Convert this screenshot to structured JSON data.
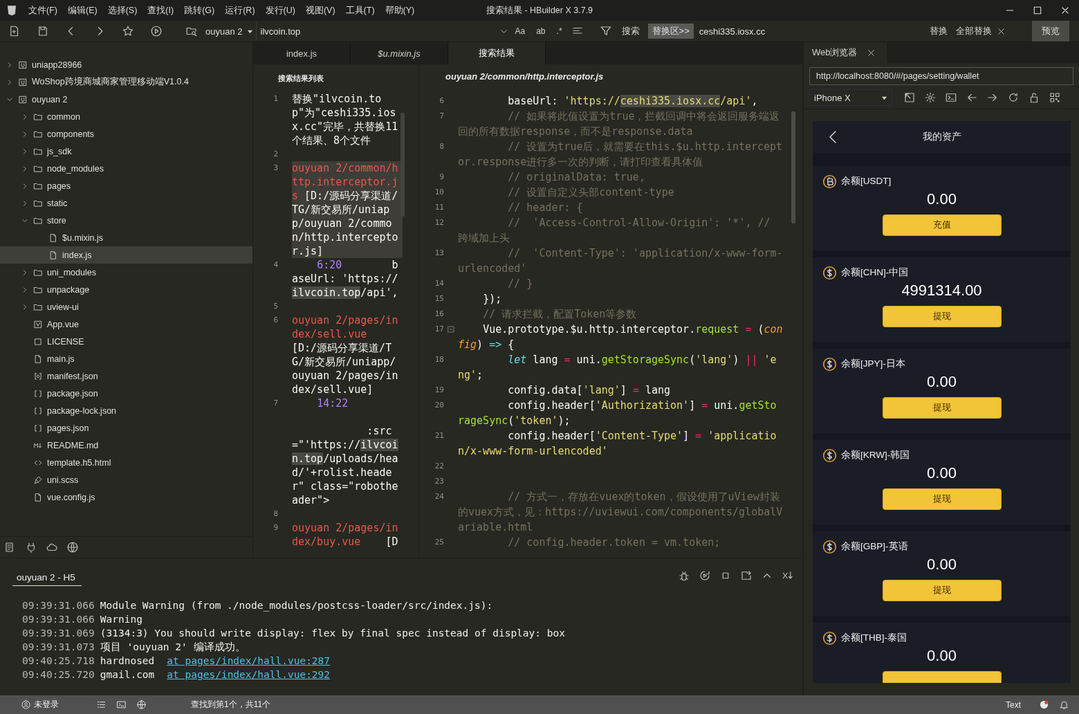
{
  "window": {
    "title": "搜索结果 - HBuilder X 3.7.9",
    "menu": [
      "文件(F)",
      "编辑(E)",
      "选择(S)",
      "查找(I)",
      "跳转(G)",
      "运行(R)",
      "发行(U)",
      "视图(V)",
      "工具(T)",
      "帮助(Y)"
    ]
  },
  "toolbar": {
    "project": "ouyuan 2",
    "search": {
      "value": "ilvcoin.top"
    },
    "search_options": [
      {
        "label": "Aa",
        "on": false
      },
      {
        "label": "ab",
        "on": false
      },
      {
        "label": ".*",
        "on": false
      }
    ],
    "search_button": "搜索",
    "replace_toggle": "替换区>>",
    "replace": {
      "value": "ceshi335.iosx.cc"
    },
    "replace_button": "替换",
    "replace_all_button": "全部替换",
    "preview_button": "预览"
  },
  "sidebar": {
    "tree": [
      {
        "label": "uniapp28966",
        "kind": "project",
        "expanded": false,
        "selected": false
      },
      {
        "label": "WoShop跨境商城商家管理移动端V1.0.4",
        "kind": "project",
        "expanded": false,
        "selected": false
      },
      {
        "label": "ouyuan 2",
        "kind": "project",
        "expanded": true,
        "selected": false,
        "children": [
          {
            "label": "common",
            "kind": "folder",
            "expanded": false,
            "selected": false
          },
          {
            "label": "components",
            "kind": "folder",
            "expanded": false,
            "selected": false
          },
          {
            "label": "js_sdk",
            "kind": "folder",
            "expanded": false,
            "selected": false
          },
          {
            "label": "node_modules",
            "kind": "folder",
            "expanded": false,
            "selected": false
          },
          {
            "label": "pages",
            "kind": "folder",
            "expanded": false,
            "selected": false
          },
          {
            "label": "static",
            "kind": "folder",
            "expanded": false,
            "selected": false
          },
          {
            "label": "store",
            "kind": "folder",
            "expanded": true,
            "selected": false,
            "children": [
              {
                "label": "$u.mixin.js",
                "kind": "js",
                "selected": false
              },
              {
                "label": "index.js",
                "kind": "js",
                "selected": true
              }
            ]
          },
          {
            "label": "uni_modules",
            "kind": "folder",
            "expanded": false,
            "selected": false
          },
          {
            "label": "unpackage",
            "kind": "folder",
            "expanded": false,
            "selected": false
          },
          {
            "label": "uview-ui",
            "kind": "folder",
            "expanded": false,
            "selected": false
          },
          {
            "label": "App.vue",
            "kind": "vue",
            "selected": false
          },
          {
            "label": "LICENSE",
            "kind": "text",
            "selected": false
          },
          {
            "label": "main.js",
            "kind": "js",
            "selected": false
          },
          {
            "label": "manifest.json",
            "kind": "manifest",
            "selected": false
          },
          {
            "label": "package.json",
            "kind": "json",
            "selected": false
          },
          {
            "label": "package-lock.json",
            "kind": "json",
            "selected": false
          },
          {
            "label": "pages.json",
            "kind": "json",
            "selected": false
          },
          {
            "label": "README.md",
            "kind": "markdown",
            "selected": false
          },
          {
            "label": "template.h5.html",
            "kind": "html",
            "selected": false
          },
          {
            "label": "uni.scss",
            "kind": "style",
            "selected": false
          },
          {
            "label": "vue.config.js",
            "kind": "js",
            "selected": false
          }
        ]
      }
    ]
  },
  "editor": {
    "tabs": [
      {
        "label": "index.js",
        "selected": false,
        "preview": false
      },
      {
        "label": "$u.mixin.js",
        "selected": false,
        "preview": true
      },
      {
        "label": "搜索结果",
        "selected": true,
        "preview": false
      }
    ],
    "results": {
      "title": "搜索结果列表",
      "lines": [
        {
          "number": "1",
          "selected": false,
          "tokens": [
            {
              "kind": "p",
              "text": "替换\"ilvcoin.top\"为\"ceshi335.iosx.cc\"完毕，共替换11个结果、8个文件"
            }
          ]
        },
        {
          "number": "2",
          "selected": false
        },
        {
          "number": "3",
          "selected": true,
          "tokens": [
            {
              "kind": "path",
              "text": "ouyuan 2/common/http.interceptor.js"
            },
            {
              "kind": "p",
              "text": " [D:/源码分享渠道/TG/新交易所/uniapp/ouyuan 2/common/http.interceptor.js]"
            }
          ]
        },
        {
          "number": "4",
          "selected": false,
          "tokens": [
            {
              "kind": "pos",
              "text": "    6:20"
            },
            {
              "kind": "p",
              "text": "        baseUrl: 'https://"
            },
            {
              "kind": "m",
              "text": "ilvcoin.top"
            },
            {
              "kind": "p",
              "text": "/api',"
            }
          ]
        },
        {
          "number": "5",
          "selected": false
        },
        {
          "number": "6",
          "selected": false,
          "tokens": [
            {
              "kind": "path",
              "text": "ouyuan 2/pages/index/sell.vue"
            },
            {
              "kind": "p",
              "text": "   [D:/源码分享渠道/TG/新交易所/uniapp/ouyuan 2/pages/index/sell.vue]"
            }
          ]
        },
        {
          "number": "7",
          "selected": false,
          "tokens": [
            {
              "kind": "pos",
              "text": "    14:22"
            },
            {
              "kind": "p",
              "text": "                                     :src=\"'https://"
            },
            {
              "kind": "m",
              "text": "ilvcoin.top"
            },
            {
              "kind": "p",
              "text": "/uploads/head/'+rolist.header\" class=\"robotheader\">"
            }
          ]
        },
        {
          "number": "8",
          "selected": false
        },
        {
          "number": "9",
          "selected": false,
          "tokens": [
            {
              "kind": "path",
              "text": "ouyuan 2/pages/index/buy.vue"
            },
            {
              "kind": "p",
              "text": "    [D"
            }
          ]
        }
      ]
    },
    "code": {
      "file": "ouyuan 2/common/http.interceptor.js",
      "lines": [
        {
          "number": "6",
          "tokens": [
            {
              "kind": "p",
              "text": "        baseUrl: "
            },
            {
              "kind": "s",
              "text": "'https://"
            },
            {
              "kind": "m",
              "text": "ceshi335.iosx.cc"
            },
            {
              "kind": "s",
              "text": "/api'"
            },
            {
              "kind": "p",
              "text": ","
            }
          ]
        },
        {
          "number": "7",
          "tokens": [
            {
              "kind": "c",
              "text": "        // 如果将此值设置为true，拦截回调中将会返回服务端返回的所有数据response，而不是response.data"
            }
          ]
        },
        {
          "number": "8",
          "tokens": [
            {
              "kind": "c",
              "text": "        // 设置为true后，就需要在this.$u.http.interceptor.response进行多一次的判断，请打印查看具体值"
            }
          ]
        },
        {
          "number": "9",
          "tokens": [
            {
              "kind": "c",
              "text": "        // originalData: true,"
            }
          ]
        },
        {
          "number": "10",
          "tokens": [
            {
              "kind": "c",
              "text": "        // 设置自定义头部content-type"
            }
          ]
        },
        {
          "number": "11",
          "tokens": [
            {
              "kind": "c",
              "text": "        // header: {"
            }
          ]
        },
        {
          "number": "12",
          "tokens": [
            {
              "kind": "c",
              "text": "        //  'Access-Control-Allow-Origin': '*', // 跨域加上头"
            }
          ]
        },
        {
          "number": "13",
          "tokens": [
            {
              "kind": "c",
              "text": "        //  'Content-Type': 'application/x-www-form-urlencoded'"
            }
          ]
        },
        {
          "number": "14",
          "tokens": [
            {
              "kind": "c",
              "text": "        // }"
            }
          ]
        },
        {
          "number": "15",
          "tokens": [
            {
              "kind": "p",
              "text": "    });"
            }
          ]
        },
        {
          "number": "16",
          "tokens": [
            {
              "kind": "c",
              "text": "    // 请求拦截，配置Token等参数"
            }
          ]
        },
        {
          "number": "17",
          "fold": true,
          "tokens": [
            {
              "kind": "p",
              "text": "    Vue.prototype.$u.http.interceptor."
            },
            {
              "kind": "f",
              "text": "request"
            },
            {
              "kind": "o",
              "text": " ="
            },
            {
              "kind": "p",
              "text": " ("
            },
            {
              "kind": "v",
              "text": "config"
            },
            {
              "kind": "p",
              "text": ") "
            },
            {
              "kind": "k",
              "text": "=>"
            },
            {
              "kind": "p",
              "text": " {"
            }
          ]
        },
        {
          "number": "18",
          "tokens": [
            {
              "kind": "k",
              "text": "        let"
            },
            {
              "kind": "p",
              "text": " lang "
            },
            {
              "kind": "o",
              "text": "="
            },
            {
              "kind": "p",
              "text": " uni."
            },
            {
              "kind": "f",
              "text": "getStorageSync"
            },
            {
              "kind": "p",
              "text": "("
            },
            {
              "kind": "s",
              "text": "'lang'"
            },
            {
              "kind": "p",
              "text": ") "
            },
            {
              "kind": "o",
              "text": "|| "
            },
            {
              "kind": "s",
              "text": "'eng'"
            },
            {
              "kind": "p",
              "text": ";"
            }
          ]
        },
        {
          "number": "19",
          "tokens": [
            {
              "kind": "p",
              "text": "        config.data["
            },
            {
              "kind": "s",
              "text": "'lang'"
            },
            {
              "kind": "p",
              "text": "] "
            },
            {
              "kind": "o",
              "text": "="
            },
            {
              "kind": "p",
              "text": " lang"
            }
          ]
        },
        {
          "number": "20",
          "tokens": [
            {
              "kind": "p",
              "text": "        config.header["
            },
            {
              "kind": "s",
              "text": "'Authorization'"
            },
            {
              "kind": "p",
              "text": "] "
            },
            {
              "kind": "o",
              "text": "="
            },
            {
              "kind": "p",
              "text": " uni."
            },
            {
              "kind": "f",
              "text": "getStorageSync"
            },
            {
              "kind": "p",
              "text": "("
            },
            {
              "kind": "s",
              "text": "'token'"
            },
            {
              "kind": "p",
              "text": ");"
            }
          ]
        },
        {
          "number": "21",
          "tokens": [
            {
              "kind": "p",
              "text": "        config.header["
            },
            {
              "kind": "s",
              "text": "'Content-Type'"
            },
            {
              "kind": "p",
              "text": "] "
            },
            {
              "kind": "o",
              "text": "= "
            },
            {
              "kind": "s",
              "text": "'application/x-www-form-urlencoded'"
            }
          ]
        },
        {
          "number": "22"
        },
        {
          "number": "23"
        },
        {
          "number": "24",
          "tokens": [
            {
              "kind": "c",
              "text": "        // 方式一，存放在vuex的token，假设使用了uView封装的vuex方式，见：https://uviewui.com/components/globalVariable.html"
            }
          ]
        },
        {
          "number": "25",
          "tokens": [
            {
              "kind": "c",
              "text": "        // config.header.token = vm.token;"
            }
          ]
        }
      ]
    }
  },
  "console": {
    "tab": "ouyuan 2 - H5",
    "lines": [
      {
        "time": "09:39:31.066",
        "text": "Module Warning (from ./node_modules/postcss-loader/src/index.js):"
      },
      {
        "time": "09:39:31.066",
        "text": "Warning"
      },
      {
        "time": "09:39:31.069",
        "text": "(3134:3) You should write display: flex by final spec instead of display: box"
      },
      {
        "time": "09:39:31.073",
        "text": "项目 'ouyuan 2' 编译成功。"
      },
      {
        "time": "09:40:25.718",
        "text": "hardnosed",
        "link": "at pages/index/hall.vue:287"
      },
      {
        "time": "09:40:25.720",
        "text": "gmail.com",
        "link": "at pages/index/hall.vue:292"
      }
    ]
  },
  "browser": {
    "tab": "Web浏览器",
    "url": "http://localhost:8080/#/pages/setting/wallet",
    "device": "iPhone X",
    "page": {
      "title": "我的资产",
      "wallets": [
        {
          "kind": "bitcoin",
          "label": "余额[USDT]",
          "amount": "0.00",
          "button": "充值"
        },
        {
          "kind": "dollar",
          "label": "余额[CHN]-中国",
          "amount": "4991314.00",
          "button": "提现"
        },
        {
          "kind": "dollar",
          "label": "余额[JPY]-日本",
          "amount": "0.00",
          "button": "提现"
        },
        {
          "kind": "dollar",
          "label": "余额[KRW]-韩国",
          "amount": "0.00",
          "button": "提现"
        },
        {
          "kind": "dollar",
          "label": "余额[GBP]-英语",
          "amount": "0.00",
          "button": "提现"
        },
        {
          "kind": "dollar",
          "label": "余额[THB]-泰国",
          "amount": "0.00"
        }
      ]
    }
  },
  "status_bar": {
    "login": "未登录",
    "find_status": "查找到第1个，共11个",
    "mode": "Text"
  }
}
